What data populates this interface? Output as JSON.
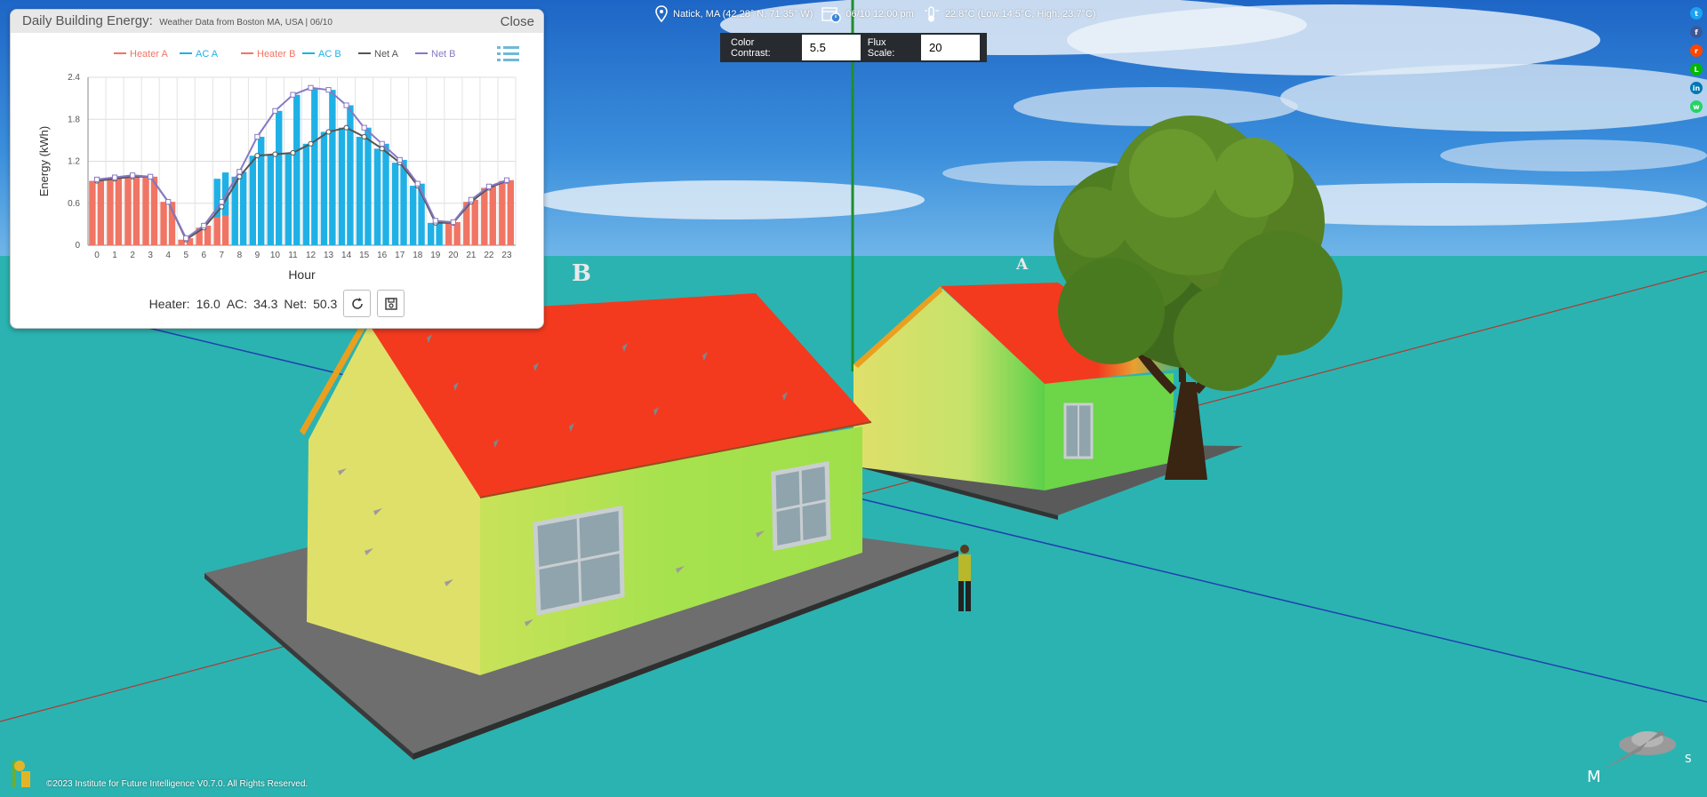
{
  "scene": {
    "house_b_label": "B",
    "house_a_label": "A"
  },
  "top_info": {
    "location": "Natick, MA (42.28° N, 71.35° W)",
    "datetime": "06/10 12:00 pm",
    "weather": "22.8°C (Low:14.5°C, High: 23.7°C)"
  },
  "controls": {
    "color_contrast_label": "Color Contrast:",
    "color_contrast_value": "5.5",
    "flux_scale_label": "Flux Scale:",
    "flux_scale_value": "20"
  },
  "energy_panel": {
    "title": "Daily Building Energy:",
    "subtitle": "Weather Data from Boston MA, USA | 06/10",
    "close_label": "Close",
    "totals": {
      "heater_label": "Heater:",
      "heater_value": "16.0",
      "ac_label": "AC:",
      "ac_value": "34.3",
      "net_label": "Net:",
      "net_value": "50.3"
    }
  },
  "chart_data": {
    "type": "bar",
    "xlabel": "Hour",
    "ylabel": "Energy (kWh)",
    "ylim": [
      0,
      2.4
    ],
    "yticks": [
      "0",
      "0.6",
      "1.2",
      "1.8",
      "2.4"
    ],
    "categories": [
      "0",
      "1",
      "2",
      "3",
      "4",
      "5",
      "6",
      "7",
      "8",
      "9",
      "10",
      "11",
      "12",
      "13",
      "14",
      "15",
      "16",
      "17",
      "18",
      "19",
      "20",
      "21",
      "22",
      "23"
    ],
    "legend_position": "top",
    "grid": true,
    "series": [
      {
        "name": "Heater A",
        "kind": "bar",
        "color": "#f07564",
        "values": [
          0.92,
          0.95,
          0.98,
          0.98,
          0.62,
          0.08,
          0.25,
          0.4,
          0,
          0,
          0,
          0,
          0,
          0,
          0,
          0,
          0,
          0,
          0,
          0,
          0.32,
          0.62,
          0.82,
          0.92
        ]
      },
      {
        "name": "AC A",
        "kind": "bar",
        "color": "#1fb1e6",
        "values": [
          0,
          0,
          0,
          0,
          0,
          0,
          0,
          0.55,
          0.98,
          1.28,
          1.3,
          1.32,
          1.45,
          1.62,
          1.68,
          1.55,
          1.38,
          1.18,
          0.85,
          0.32,
          0,
          0,
          0,
          0
        ]
      },
      {
        "name": "Heater B",
        "kind": "bar",
        "color": "#f07564",
        "values": [
          0.94,
          0.97,
          1.0,
          0.98,
          0.62,
          0.1,
          0.28,
          0.42,
          0,
          0,
          0,
          0,
          0,
          0,
          0,
          0,
          0,
          0,
          0,
          0,
          0.33,
          0.65,
          0.84,
          0.93
        ]
      },
      {
        "name": "AC B",
        "kind": "bar",
        "color": "#1fb1e6",
        "values": [
          0,
          0,
          0,
          0,
          0,
          0,
          0,
          0.62,
          1.05,
          1.55,
          1.92,
          2.15,
          2.25,
          2.22,
          2.0,
          1.68,
          1.45,
          1.22,
          0.88,
          0.35,
          0,
          0,
          0,
          0
        ]
      },
      {
        "name": "Net A",
        "kind": "line",
        "color": "#555555",
        "values": [
          0.92,
          0.95,
          0.98,
          0.98,
          0.62,
          0.08,
          0.25,
          0.55,
          0.98,
          1.28,
          1.3,
          1.32,
          1.45,
          1.62,
          1.68,
          1.55,
          1.38,
          1.18,
          0.85,
          0.32,
          0.32,
          0.62,
          0.82,
          0.92
        ]
      },
      {
        "name": "Net B",
        "kind": "line",
        "color": "#8878c3",
        "values": [
          0.94,
          0.97,
          1.0,
          0.98,
          0.62,
          0.1,
          0.28,
          0.62,
          1.05,
          1.55,
          1.92,
          2.15,
          2.25,
          2.22,
          2.0,
          1.68,
          1.45,
          1.22,
          0.88,
          0.35,
          0.33,
          0.65,
          0.84,
          0.93
        ]
      }
    ]
  },
  "copyright": "©2023 Institute for Future Intelligence V0.7.0. All Rights Reserved.",
  "share": {
    "icons": [
      "twitter-icon",
      "facebook-icon",
      "reddit-icon",
      "line-icon",
      "linkedin-icon",
      "whatsapp-icon"
    ],
    "colors": [
      "#1da1f2",
      "#3b5998",
      "#ff4500",
      "#00b900",
      "#0077b5",
      "#25d366"
    ]
  },
  "colors": {
    "ground": "#2bb3b1",
    "sky_top": "#1f6fc9",
    "roof": "#f33a1e",
    "wall_warm": "#dfe06a",
    "wall_green": "#a7e24f"
  }
}
